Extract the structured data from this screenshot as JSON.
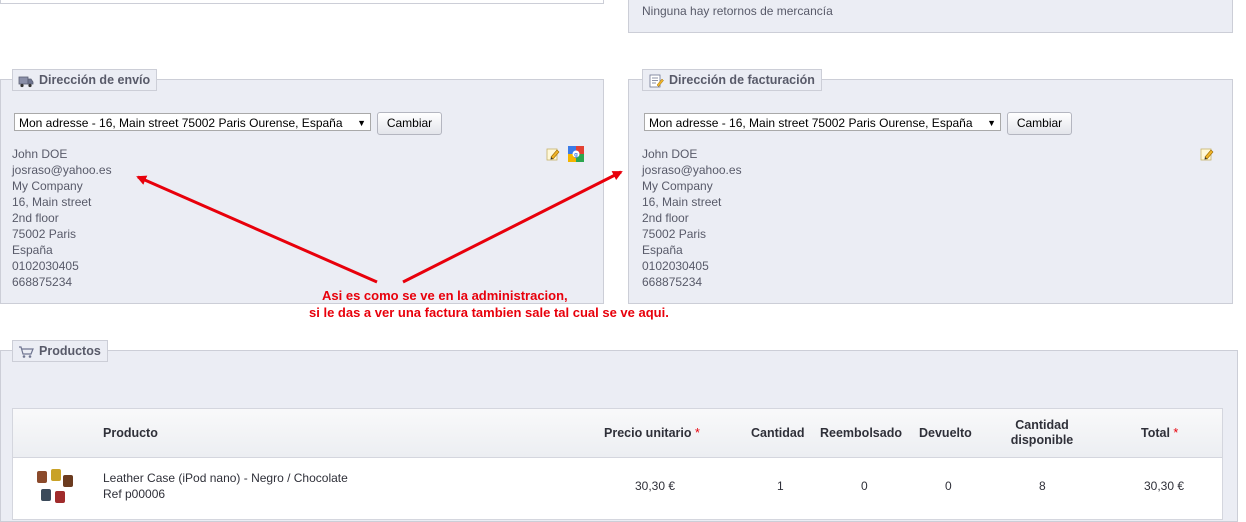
{
  "returns": {
    "text": "Ninguna hay retornos de mercancía"
  },
  "shipping": {
    "legend": "Dirección de envío",
    "icon": "truck-icon",
    "select_value": "Mon adresse - 16, Main street 75002 Paris Ourense, España",
    "change_button": "Cambiar",
    "lines": [
      "John DOE",
      "josraso@yahoo.es",
      "My Company",
      "16, Main street",
      "2nd floor",
      "75002 Paris",
      "España",
      "0102030405",
      "668875234"
    ]
  },
  "billing": {
    "legend": "Dirección de facturación",
    "icon": "invoice-icon",
    "select_value": "Mon adresse - 16, Main street 75002 Paris Ourense, España",
    "change_button": "Cambiar",
    "lines": [
      "John DOE",
      "josraso@yahoo.es",
      "My Company",
      "16, Main street",
      "2nd floor",
      "75002 Paris",
      "España",
      "0102030405",
      "668875234"
    ]
  },
  "annotation": {
    "line1": "Asi es como se ve en la administracion,",
    "line2": "si le das a ver una factura tambien sale tal cual se ve aqui."
  },
  "products": {
    "legend": "Productos",
    "icon": "cart-icon",
    "headers": {
      "product": "Producto",
      "unit_price": "Precio unitario",
      "quantity": "Cantidad",
      "refunded": "Reembolsado",
      "returned": "Devuelto",
      "available_1": "Cantidad",
      "available_2": "disponible",
      "total": "Total",
      "required_mark": "*"
    },
    "rows": [
      {
        "name": "Leather Case (iPod nano) - Negro / Chocolate",
        "ref": "Ref p00006",
        "unit_price": "30,30 €",
        "quantity": "1",
        "refunded": "0",
        "returned": "0",
        "available": "8",
        "total": "30,30 €"
      }
    ]
  },
  "colors": {
    "panel_bg": "#ebedf4",
    "border": "#ccced7",
    "annotation_red": "#e8000b"
  }
}
